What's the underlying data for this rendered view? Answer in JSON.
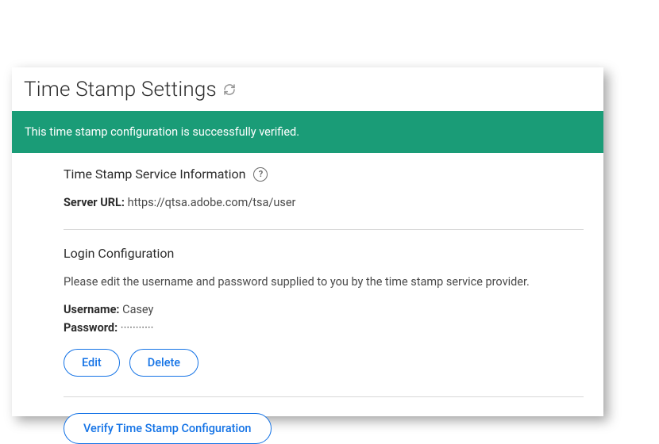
{
  "page": {
    "title": "Time Stamp Settings"
  },
  "banner": {
    "message": "This time stamp configuration is successfully verified."
  },
  "serviceInfo": {
    "title": "Time Stamp Service Information",
    "serverUrl": {
      "label": "Server URL:",
      "value": "https://qtsa.adobe.com/tsa/user"
    }
  },
  "loginConfig": {
    "title": "Login Configuration",
    "description": "Please edit the username and password supplied to you by the time stamp service provider.",
    "username": {
      "label": "Username:",
      "value": "Casey"
    },
    "password": {
      "label": "Password:",
      "value": "···········"
    }
  },
  "buttons": {
    "edit": "Edit",
    "delete": "Delete",
    "verify": "Verify Time Stamp Configuration"
  }
}
